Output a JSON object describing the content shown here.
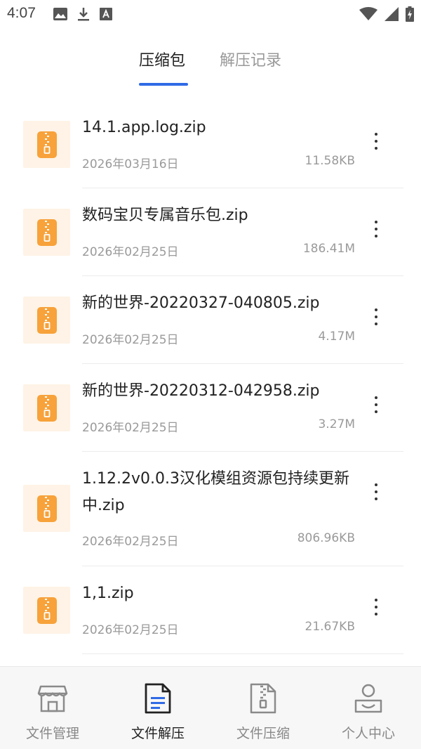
{
  "status_bar": {
    "time": "4:07",
    "left_icons": [
      "image-icon",
      "download-icon",
      "font-a-icon"
    ],
    "right_icons": [
      "wifi-icon",
      "signal-icon",
      "battery-charging-icon"
    ]
  },
  "tabs": [
    {
      "label": "压缩包",
      "active": true
    },
    {
      "label": "解压记录",
      "active": false
    }
  ],
  "accent_color": "#2f6be6",
  "zip_icon_color": "#f7a23b",
  "files": [
    {
      "name": "14.1.app.log.zip",
      "date": "2026年03月16日",
      "size": "11.58KB"
    },
    {
      "name": "数码宝贝专属音乐包.zip",
      "date": "2026年02月25日",
      "size": "186.41M"
    },
    {
      "name": "新的世界-20220327-040805.zip",
      "date": "2026年02月25日",
      "size": "4.17M"
    },
    {
      "name": "新的世界-20220312-042958.zip",
      "date": "2026年02月25日",
      "size": "3.27M"
    },
    {
      "name": "1.12.2v0.0.3汉化模组资源包持续更新中.zip",
      "date": "2026年02月25日",
      "size": "806.96KB"
    },
    {
      "name": "1,1.zip",
      "date": "2026年02月25日",
      "size": "21.67KB"
    }
  ],
  "bottom_nav": [
    {
      "label": "文件管理",
      "icon": "store-icon",
      "active": false
    },
    {
      "label": "文件解压",
      "icon": "document-icon",
      "active": true
    },
    {
      "label": "文件压缩",
      "icon": "zip-file-icon",
      "active": false
    },
    {
      "label": "个人中心",
      "icon": "user-icon",
      "active": false
    }
  ]
}
